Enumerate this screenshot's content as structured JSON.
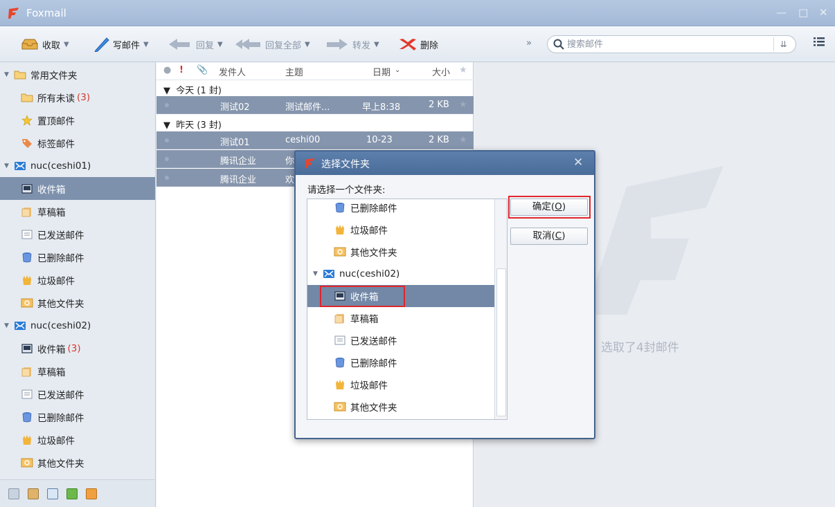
{
  "app": {
    "title": "Foxmail",
    "brand_color": "#e8452c"
  },
  "toolbar": {
    "receive": "收取",
    "compose": "写邮件",
    "reply": "回复",
    "reply_all": "回复全部",
    "forward": "转发",
    "delete": "删除",
    "more": "»",
    "search_placeholder": "搜索邮件",
    "filter_icon": "chevron-double-down-icon",
    "menu_icon": "menu-icon"
  },
  "sidebar": {
    "groups": [
      {
        "label": "常用文件夹",
        "items": [
          {
            "label": "所有未读",
            "count": "(3)",
            "icon": "folder-icon"
          },
          {
            "label": "置顶邮件",
            "icon": "star-icon"
          },
          {
            "label": "标签邮件",
            "icon": "tag-icon"
          }
        ]
      },
      {
        "label": "nuc(ceshi01)",
        "items": [
          {
            "label": "收件箱",
            "icon": "inbox-icon",
            "selected": true
          },
          {
            "label": "草稿箱",
            "icon": "drafts-icon"
          },
          {
            "label": "已发送邮件",
            "icon": "sent-icon"
          },
          {
            "label": "已删除邮件",
            "icon": "trash-icon"
          },
          {
            "label": "垃圾邮件",
            "icon": "junk-icon"
          },
          {
            "label": "其他文件夹",
            "icon": "other-folder-icon"
          }
        ]
      },
      {
        "label": "nuc(ceshi02)",
        "items": [
          {
            "label": "收件箱",
            "count": "(3)",
            "icon": "inbox-icon"
          },
          {
            "label": "草稿箱",
            "icon": "drafts-icon"
          },
          {
            "label": "已发送邮件",
            "icon": "sent-icon"
          },
          {
            "label": "已删除邮件",
            "icon": "trash-icon"
          },
          {
            "label": "垃圾邮件",
            "icon": "junk-icon"
          },
          {
            "label": "其他文件夹",
            "icon": "other-folder-icon"
          }
        ]
      }
    ],
    "bottom_icons": [
      "mail-icon",
      "contacts-icon",
      "calendar-icon",
      "notes-icon",
      "rss-icon"
    ]
  },
  "maillist": {
    "columns": {
      "from": "发件人",
      "subject": "主题",
      "date": "日期",
      "size": "大小"
    },
    "groups": [
      {
        "label": "今天 (1 封)",
        "rows": [
          {
            "from": "测试02",
            "subject": "测试邮件...",
            "date": "早上8:38",
            "size": "2 KB"
          }
        ]
      },
      {
        "label": "昨天 (3 封)",
        "rows": [
          {
            "from": "测试01",
            "subject": "ceshi00",
            "date": "10-23",
            "size": "2 KB"
          },
          {
            "from": "腾讯企业",
            "subject": "你",
            "date": "",
            "size": ""
          },
          {
            "from": "腾讯企业",
            "subject": "欢",
            "date": "",
            "size": ""
          }
        ]
      }
    ]
  },
  "preview": {
    "selected_text": "选取了4封邮件"
  },
  "dialog": {
    "title": "选择文件夹",
    "prompt": "请选择一个文件夹:",
    "tree": [
      {
        "label": "已删除邮件",
        "icon": "trash-icon"
      },
      {
        "label": "垃圾邮件",
        "icon": "junk-icon"
      },
      {
        "label": "其他文件夹",
        "icon": "other-folder-icon"
      },
      {
        "label": "nuc(ceshi02)",
        "icon": "account-icon",
        "account": true
      },
      {
        "label": "收件箱",
        "icon": "inbox-icon",
        "selected": true
      },
      {
        "label": "草稿箱",
        "icon": "drafts-icon"
      },
      {
        "label": "已发送邮件",
        "icon": "sent-icon"
      },
      {
        "label": "已删除邮件",
        "icon": "trash-icon"
      },
      {
        "label": "垃圾邮件",
        "icon": "junk-icon"
      },
      {
        "label": "其他文件夹",
        "icon": "other-folder-icon"
      }
    ],
    "ok": {
      "text": "确定(",
      "key": "O",
      "close": ")"
    },
    "cancel": {
      "text": "取消(",
      "key": "C",
      "close": ")"
    }
  }
}
